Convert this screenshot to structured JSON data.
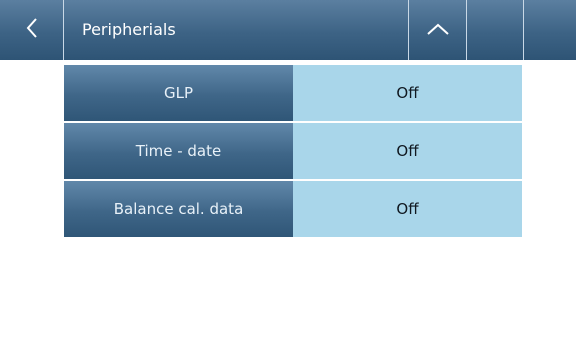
{
  "header": {
    "title": "Peripherials",
    "back_icon": "chevron-left-icon",
    "up_icon": "chevron-up-icon"
  },
  "settings": [
    {
      "label": "GLP",
      "value": "Off"
    },
    {
      "label": "Time - date",
      "value": "Off"
    },
    {
      "label": "Balance cal. data",
      "value": "Off"
    }
  ],
  "colors": {
    "header_bg": "#3d6385",
    "label_bg": "#3f6688",
    "value_bg": "#a9d6ea",
    "divider": "#c9d8e6"
  }
}
